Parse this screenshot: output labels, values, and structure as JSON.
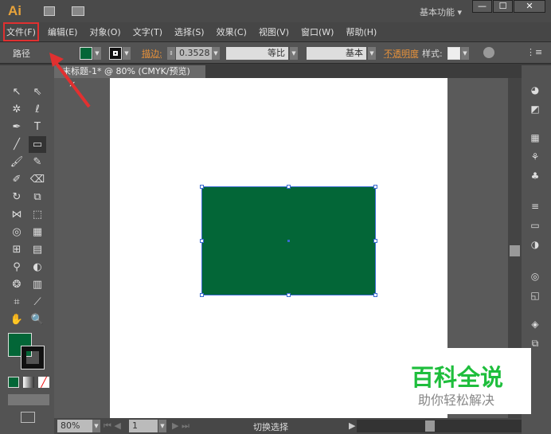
{
  "app": {
    "logo": "Ai",
    "workspace": "基本功能 ▾",
    "window_buttons": [
      "—",
      "☐",
      "✕"
    ]
  },
  "menu": [
    "文件(F)",
    "编辑(E)",
    "对象(O)",
    "文字(T)",
    "选择(S)",
    "效果(C)",
    "视图(V)",
    "窗口(W)",
    "帮助(H)"
  ],
  "control": {
    "selection_type": "路径",
    "stroke_label": "描边:",
    "stroke_value": "0.3528",
    "profile": "等比",
    "brush": "基本",
    "opacity_label": "不透明度",
    "style_label": "样式:",
    "fill_color": "#036637"
  },
  "document": {
    "tab_title": "未标题-1* @ 80% (CMYK/预览)",
    "close": "×"
  },
  "status": {
    "zoom": "80%",
    "artboard": "1",
    "tool_status": "切换选择"
  },
  "watermark": {
    "title": "百科全说",
    "subtitle": "助你轻松解决"
  }
}
